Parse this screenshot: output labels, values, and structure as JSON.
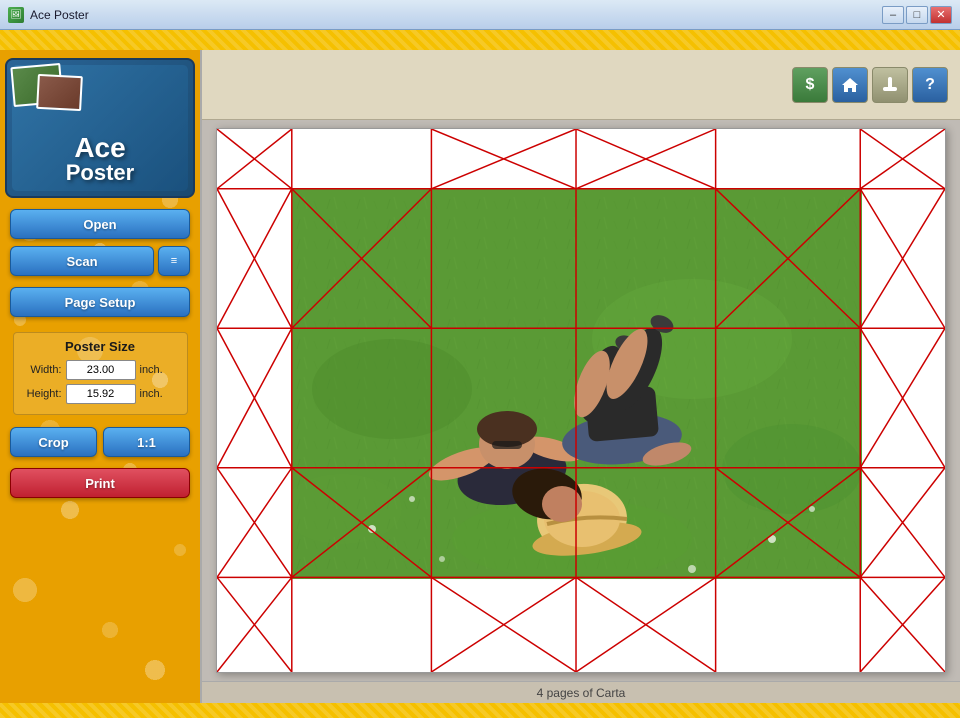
{
  "titlebar": {
    "title": "Ace Poster",
    "icon": "🖼",
    "minimize": "–",
    "maximize": "□",
    "close": "✕"
  },
  "toolbar": {
    "dollar_label": "$",
    "home_label": "🏠",
    "tools_label": "🔧",
    "help_label": "?"
  },
  "sidebar": {
    "logo_ace": "Ace",
    "logo_poster": "Poster",
    "open_label": "Open",
    "scan_label": "Scan",
    "menu_icon": "≡",
    "page_setup_label": "Page Setup",
    "poster_size_title": "Poster Size",
    "width_label": "Width:",
    "width_value": "23.00",
    "width_unit": "inch.",
    "height_label": "Height:",
    "height_value": "15.92",
    "height_unit": "inch.",
    "crop_label": "Crop",
    "ratio_label": "1:1",
    "print_label": "Print"
  },
  "statusbar": {
    "text": "4 pages of Carta"
  },
  "canvas": {
    "grid_color": "#cc0000",
    "paper_bg": "#ffffff"
  }
}
